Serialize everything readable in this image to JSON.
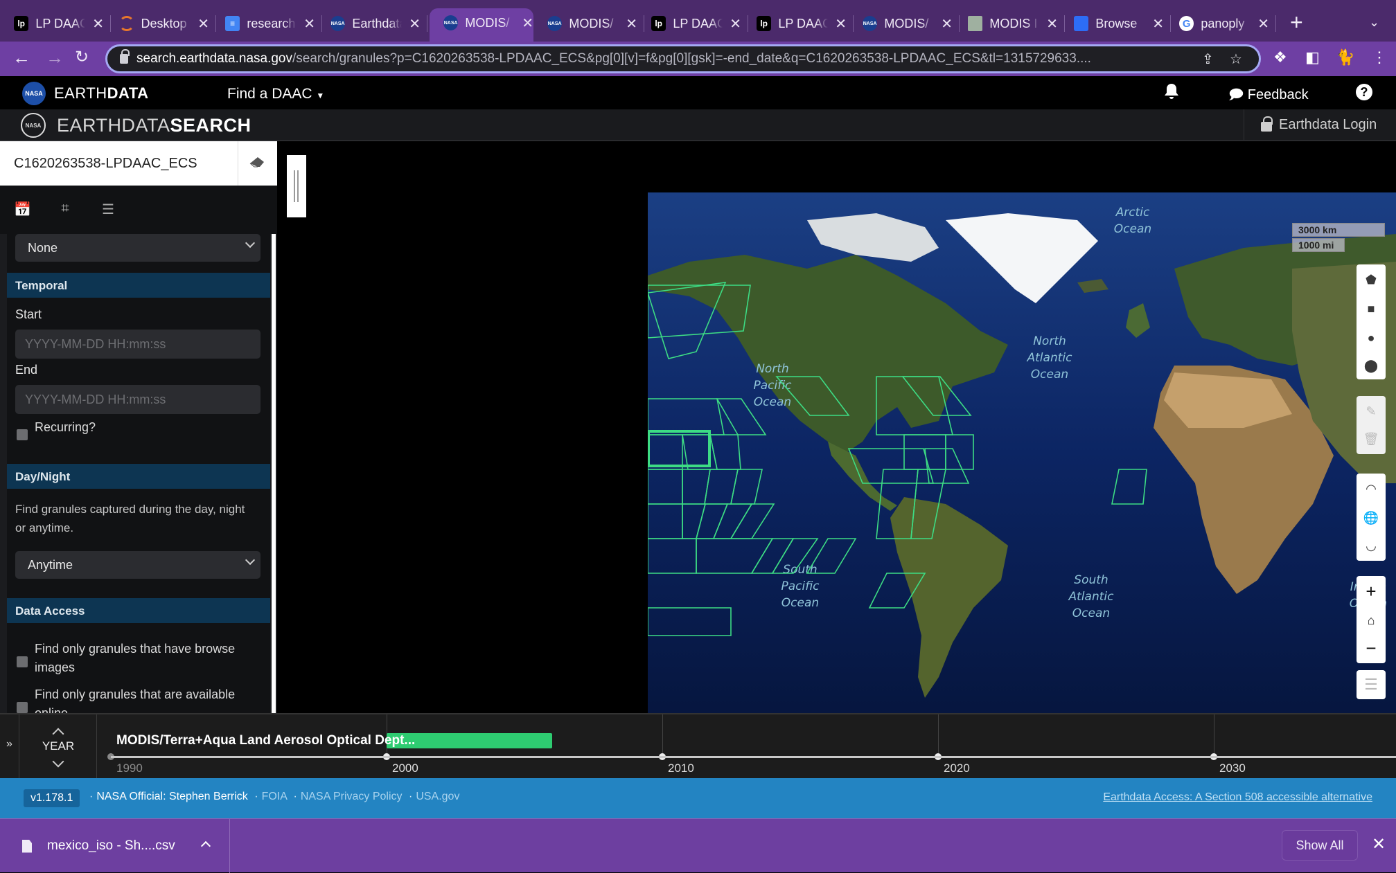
{
  "browser": {
    "tabs": [
      {
        "title": "LP DAAC",
        "favicon": "lp-daac-icon",
        "active": false
      },
      {
        "title": "Desktop",
        "favicon": "desktop-app-icon",
        "active": false
      },
      {
        "title": "research",
        "favicon": "google-docs-icon",
        "active": false
      },
      {
        "title": "Earthdata",
        "favicon": "nasa-icon",
        "active": false
      },
      {
        "title": "MODIS/",
        "favicon": "nasa-icon",
        "active": true
      },
      {
        "title": "MODIS/",
        "favicon": "nasa-icon",
        "active": false
      },
      {
        "title": "LP DAAC",
        "favicon": "lp-daac-icon",
        "active": false
      },
      {
        "title": "LP DAAC",
        "favicon": "lp-daac-icon",
        "active": false
      },
      {
        "title": "MODIS/",
        "favicon": "nasa-icon",
        "active": false
      },
      {
        "title": "MODIS I",
        "favicon": "image-icon",
        "active": false
      },
      {
        "title": "Browse",
        "favicon": "browse-icon",
        "active": false
      },
      {
        "title": "panoply",
        "favicon": "google-icon",
        "active": false
      }
    ],
    "new_tab_label": "+",
    "url_host": "search.earthdata.nasa.gov",
    "url_path": "/search/granules?p=C1620263538-LPDAAC_ECS&pg[0][v]=f&pg[0][gsk]=-end_date&q=C1620263538-LPDAAC_ECS&tl=1315729633...."
  },
  "earthdata_header": {
    "brand_light": "EARTH",
    "brand_bold": "DATA",
    "find_daac": "Find a DAAC",
    "feedback": "Feedback",
    "help": "?"
  },
  "search_header": {
    "title_light": "EARTHDATA",
    "title_bold": "SEARCH",
    "login": "Earthdata Login"
  },
  "sidebar": {
    "query_value": "C1620263538-LPDAAC_ECS",
    "top_select": "None",
    "temporal": {
      "heading": "Temporal",
      "start_label": "Start",
      "start_placeholder": "YYYY-MM-DD HH:mm:ss",
      "end_label": "End",
      "end_placeholder": "YYYY-MM-DD HH:mm:ss",
      "recurring_label": "Recurring?"
    },
    "day_night": {
      "heading": "Day/Night",
      "description": "Find granules captured during the day, night or anytime.",
      "selected": "Anytime"
    },
    "data_access": {
      "heading": "Data Access",
      "browse_label": "Find only granules that have browse images",
      "online_label": "Find only granules that are available online"
    }
  },
  "map": {
    "scale_km": "3000 km",
    "scale_mi": "1000 mi",
    "labels": [
      {
        "text": "Arctic\nOcean"
      },
      {
        "text": "North\nPacific\nOcean"
      },
      {
        "text": "North\nAtlantic\nOcean"
      },
      {
        "text": "South\nPacific\nOcean"
      },
      {
        "text": "South\nAtlantic\nOcean"
      },
      {
        "text": "Indian\nOcean"
      }
    ],
    "granule_color": "#3ddc84"
  },
  "timeline": {
    "zoom_level": "YEAR",
    "collection_name": "MODIS/Terra+Aqua Land Aerosol Optical Dept...",
    "years": [
      "1990",
      "2000",
      "2010",
      "2020",
      "2030"
    ],
    "data_range": {
      "start_year": 2000.0,
      "end_year": 2006.0
    },
    "bar_color": "#2ecc71"
  },
  "footer": {
    "version": "v1.178.1",
    "official": "NASA Official: Stephen Berrick",
    "links": [
      "FOIA",
      "NASA Privacy Policy",
      "USA.gov"
    ],
    "accessible": "Earthdata Access: A Section 508 accessible alternative"
  },
  "downloads": {
    "file": "mexico_iso - Sh....csv",
    "show_all": "Show All"
  }
}
